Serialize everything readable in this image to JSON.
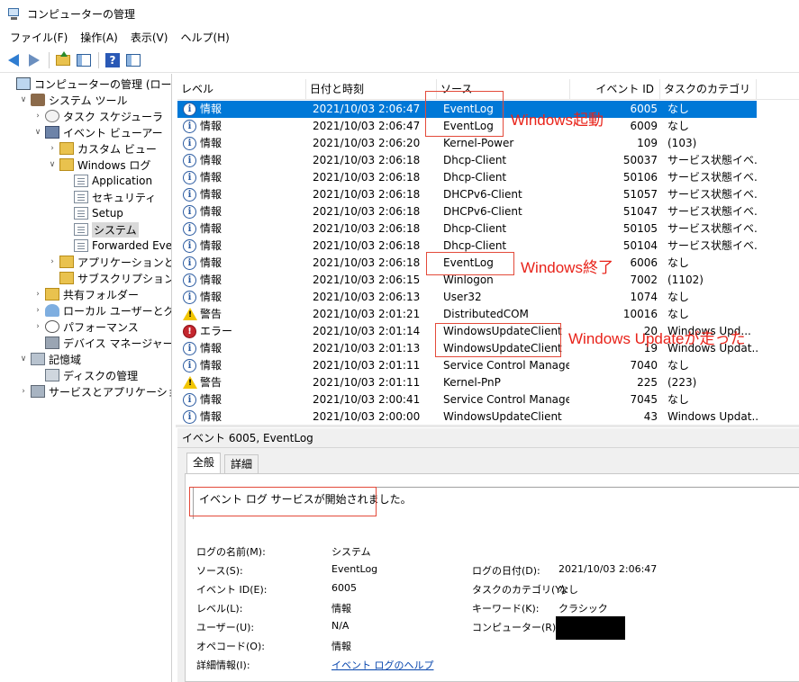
{
  "window": {
    "title": "コンピューターの管理"
  },
  "menubar": [
    {
      "label": "ファイル(F)"
    },
    {
      "label": "操作(A)"
    },
    {
      "label": "表示(V)"
    },
    {
      "label": "ヘルプ(H)"
    }
  ],
  "tree": [
    {
      "label": "コンピューターの管理 (ローカル)",
      "icon": "computer-icon",
      "exp": "",
      "depth": 0
    },
    {
      "label": "システム ツール",
      "icon": "tools-icon",
      "exp": "v",
      "depth": 1
    },
    {
      "label": "タスク スケジューラ",
      "icon": "clock-icon",
      "exp": ">",
      "depth": 2
    },
    {
      "label": "イベント ビューアー",
      "icon": "event-viewer-icon",
      "exp": "v",
      "depth": 2
    },
    {
      "label": "カスタム ビュー",
      "icon": "folder-icon",
      "exp": ">",
      "depth": 3
    },
    {
      "label": "Windows ログ",
      "icon": "folder-icon",
      "exp": "v",
      "depth": 3
    },
    {
      "label": "Application",
      "icon": "log-icon",
      "exp": "",
      "depth": 4
    },
    {
      "label": "セキュリティ",
      "icon": "log-icon",
      "exp": "",
      "depth": 4
    },
    {
      "label": "Setup",
      "icon": "log-icon",
      "exp": "",
      "depth": 4
    },
    {
      "label": "システム",
      "icon": "log-icon",
      "exp": "",
      "depth": 4,
      "selected": true
    },
    {
      "label": "Forwarded Event",
      "icon": "log-icon",
      "exp": "",
      "depth": 4
    },
    {
      "label": "アプリケーションとサービ",
      "icon": "folder-icon",
      "exp": ">",
      "depth": 3
    },
    {
      "label": "サブスクリプション",
      "icon": "folder-icon",
      "exp": "",
      "depth": 3
    },
    {
      "label": "共有フォルダー",
      "icon": "shared-folder-icon",
      "exp": ">",
      "depth": 2
    },
    {
      "label": "ローカル ユーザーとグループ",
      "icon": "users-icon",
      "exp": ">",
      "depth": 2
    },
    {
      "label": "パフォーマンス",
      "icon": "performance-icon",
      "exp": ">",
      "depth": 2
    },
    {
      "label": "デバイス マネージャー",
      "icon": "device-manager-icon",
      "exp": "",
      "depth": 2
    },
    {
      "label": "記憶域",
      "icon": "storage-icon",
      "exp": "v",
      "depth": 1
    },
    {
      "label": "ディスクの管理",
      "icon": "disk-icon",
      "exp": "",
      "depth": 2
    },
    {
      "label": "サービスとアプリケーション",
      "icon": "services-icon",
      "exp": ">",
      "depth": 1
    }
  ],
  "columns": {
    "level": "レベル",
    "datetime": "日付と時刻",
    "source": "ソース",
    "event_id": "イベント ID",
    "category": "タスクのカテゴリ"
  },
  "events": [
    {
      "level_type": "info",
      "level": "情報",
      "datetime": "2021/10/03 2:06:47",
      "source": "EventLog",
      "event_id": "6005",
      "category": "なし",
      "selected": true
    },
    {
      "level_type": "info",
      "level": "情報",
      "datetime": "2021/10/03 2:06:47",
      "source": "EventLog",
      "event_id": "6009",
      "category": "なし"
    },
    {
      "level_type": "info",
      "level": "情報",
      "datetime": "2021/10/03 2:06:20",
      "source": "Kernel-Power",
      "event_id": "109",
      "category": "(103)"
    },
    {
      "level_type": "info",
      "level": "情報",
      "datetime": "2021/10/03 2:06:18",
      "source": "Dhcp-Client",
      "event_id": "50037",
      "category": "サービス状態イベ..."
    },
    {
      "level_type": "info",
      "level": "情報",
      "datetime": "2021/10/03 2:06:18",
      "source": "Dhcp-Client",
      "event_id": "50106",
      "category": "サービス状態イベ..."
    },
    {
      "level_type": "info",
      "level": "情報",
      "datetime": "2021/10/03 2:06:18",
      "source": "DHCPv6-Client",
      "event_id": "51057",
      "category": "サービス状態イベ..."
    },
    {
      "level_type": "info",
      "level": "情報",
      "datetime": "2021/10/03 2:06:18",
      "source": "DHCPv6-Client",
      "event_id": "51047",
      "category": "サービス状態イベ..."
    },
    {
      "level_type": "info",
      "level": "情報",
      "datetime": "2021/10/03 2:06:18",
      "source": "Dhcp-Client",
      "event_id": "50105",
      "category": "サービス状態イベ..."
    },
    {
      "level_type": "info",
      "level": "情報",
      "datetime": "2021/10/03 2:06:18",
      "source": "Dhcp-Client",
      "event_id": "50104",
      "category": "サービス状態イベ..."
    },
    {
      "level_type": "info",
      "level": "情報",
      "datetime": "2021/10/03 2:06:18",
      "source": "EventLog",
      "event_id": "6006",
      "category": "なし"
    },
    {
      "level_type": "info",
      "level": "情報",
      "datetime": "2021/10/03 2:06:15",
      "source": "Winlogon",
      "event_id": "7002",
      "category": "(1102)"
    },
    {
      "level_type": "info",
      "level": "情報",
      "datetime": "2021/10/03 2:06:13",
      "source": "User32",
      "event_id": "1074",
      "category": "なし"
    },
    {
      "level_type": "warn",
      "level": "警告",
      "datetime": "2021/10/03 2:01:21",
      "source": "DistributedCOM",
      "event_id": "10016",
      "category": "なし"
    },
    {
      "level_type": "error",
      "level": "エラー",
      "datetime": "2021/10/03 2:01:14",
      "source": "WindowsUpdateClient",
      "event_id": "20",
      "category": "Windows Upd..."
    },
    {
      "level_type": "info",
      "level": "情報",
      "datetime": "2021/10/03 2:01:13",
      "source": "WindowsUpdateClient",
      "event_id": "19",
      "category": "Windows Updat..."
    },
    {
      "level_type": "info",
      "level": "情報",
      "datetime": "2021/10/03 2:01:11",
      "source": "Service Control Manager",
      "event_id": "7040",
      "category": "なし"
    },
    {
      "level_type": "warn",
      "level": "警告",
      "datetime": "2021/10/03 2:01:11",
      "source": "Kernel-PnP",
      "event_id": "225",
      "category": "(223)"
    },
    {
      "level_type": "info",
      "level": "情報",
      "datetime": "2021/10/03 2:00:41",
      "source": "Service Control Manager",
      "event_id": "7045",
      "category": "なし"
    },
    {
      "level_type": "info",
      "level": "情報",
      "datetime": "2021/10/03 2:00:00",
      "source": "WindowsUpdateClient",
      "event_id": "43",
      "category": "Windows Updat..."
    }
  ],
  "annotations": {
    "startup": "Windows起動",
    "shutdown": "Windows終了",
    "update": "Windows Updateが走った",
    "color": "#e8231a"
  },
  "detail": {
    "title": "イベント 6005, EventLog",
    "tab_general": "全般",
    "tab_details": "詳細",
    "description": "イベント ログ サービスが開始されました。",
    "fields_left": [
      {
        "label": "ログの名前(M):",
        "value": "システム"
      },
      {
        "label": "ソース(S):",
        "value": "EventLog"
      },
      {
        "label": "イベント ID(E):",
        "value": "6005"
      },
      {
        "label": "レベル(L):",
        "value": "情報"
      },
      {
        "label": "ユーザー(U):",
        "value": "N/A"
      },
      {
        "label": "オペコード(O):",
        "value": "情報"
      },
      {
        "label": "詳細情報(I):",
        "value": "イベント ログのヘルプ"
      }
    ],
    "fields_right": [
      {
        "label": "ログの日付(D):",
        "value": "2021/10/03 2:06:47"
      },
      {
        "label": "タスクのカテゴリ(Y):",
        "value": "なし"
      },
      {
        "label": "キーワード(K):",
        "value": "クラシック"
      },
      {
        "label": "コンピューター(R):",
        "value": ""
      }
    ]
  }
}
